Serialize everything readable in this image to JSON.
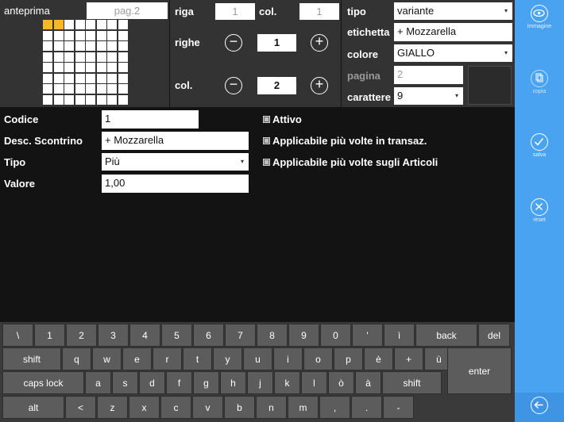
{
  "preview": {
    "label": "anteprima",
    "page": "pag.2",
    "grid_rows": 8,
    "grid_cols": 8,
    "highlight_color": "#f2b92b",
    "highlighted_cells": [
      0,
      1
    ]
  },
  "dims": {
    "riga_label": "riga",
    "riga_value": "1",
    "col_label": "col.",
    "col_value": "1",
    "righe_label": "righe",
    "righe_value": "1",
    "cols_label": "col.",
    "cols_value": "2"
  },
  "type_panel": {
    "tipo_label": "tipo",
    "tipo_value": "variante",
    "etichetta_label": "etichetta",
    "etichetta_value": "+ Mozzarella",
    "colore_label": "colore",
    "colore_value": "GIALLO",
    "pagina_label": "pagina",
    "pagina_value": "2",
    "carattere_label": "carattere",
    "carattere_value": "9"
  },
  "form": {
    "codice_label": "Codice",
    "codice_value": "1",
    "desc_label": "Desc. Scontrino",
    "desc_value": "+ Mozzarella",
    "tipo_label": "Tipo",
    "tipo_value": "Più",
    "valore_label": "Valore",
    "valore_value": "1,00",
    "attivo_label": "Attivo",
    "transaz_label": "Applicabile più volte in transaz.",
    "articoli_label": "Applicabile più volte sugli Articoli"
  },
  "keyboard": {
    "row1": [
      "\\",
      "1",
      "2",
      "3",
      "4",
      "5",
      "6",
      "7",
      "8",
      "9",
      "0",
      "'",
      "ì",
      "back",
      "del"
    ],
    "row2": [
      "shift",
      "q",
      "w",
      "e",
      "r",
      "t",
      "y",
      "u",
      "i",
      "o",
      "p",
      "è",
      "+",
      "ù"
    ],
    "enter": "enter",
    "row3": [
      "caps lock",
      "a",
      "s",
      "d",
      "f",
      "g",
      "h",
      "j",
      "k",
      "l",
      "ò",
      "à",
      "shift"
    ],
    "row4": [
      "alt",
      "<",
      "z",
      "x",
      "c",
      "v",
      "b",
      "n",
      "m",
      ",",
      ".",
      "-"
    ]
  },
  "sidebar": {
    "immagine_label": "immagine",
    "copia_label": "copia",
    "salva_label": "salva",
    "reset_label": "reset"
  }
}
